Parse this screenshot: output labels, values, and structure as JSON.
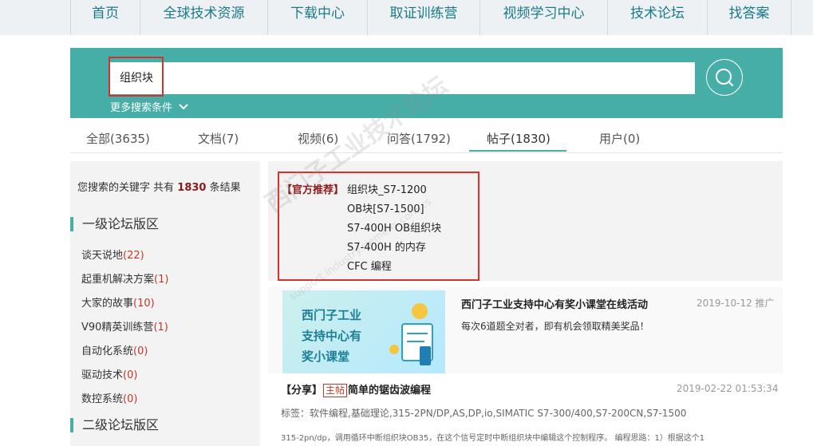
{
  "nav": {
    "items": [
      "首页",
      "全球技术资源",
      "下载中心",
      "取证训练营",
      "视频学习中心",
      "技术论坛",
      "找答案"
    ]
  },
  "search": {
    "value": "组织块",
    "more_conditions": "更多搜索条件"
  },
  "tabs": [
    {
      "label": "全部(3635)"
    },
    {
      "label": "文档(7)"
    },
    {
      "label": "视频(6)"
    },
    {
      "label": "问答(1792)"
    },
    {
      "label": "帖子(1830)",
      "active": true
    },
    {
      "label": "用户(0)"
    }
  ],
  "sidebar": {
    "summary_prefix": "您搜索的关键字 共有",
    "summary_count": "1830",
    "summary_suffix": "条结果",
    "section1_title": "一级论坛版区",
    "forums": [
      {
        "name": "谈天说地",
        "count": "(22)"
      },
      {
        "name": "起重机解决方案",
        "count": "(1)"
      },
      {
        "name": "大家的故事",
        "count": "(10)"
      },
      {
        "name": "V90精英训练营",
        "count": "(1)"
      },
      {
        "name": "自动化系统",
        "count": "(0)"
      },
      {
        "name": "驱动技术",
        "count": "(0)"
      },
      {
        "name": "数控系统",
        "count": "(0)"
      }
    ],
    "section2_title": "二级论坛版区"
  },
  "recommend": {
    "tag": "【官方推荐】",
    "links": [
      "组织块_S7-1200",
      "OB块[S7-1500]",
      "S7-400H OB组织块",
      "S7-400H 的内存",
      "CFC 编程"
    ]
  },
  "promo": {
    "image_lines": [
      "西门子工业",
      "支持中心有",
      "奖小课堂"
    ],
    "title": "西门子工业支持中心有奖小课堂在线活动",
    "date": "2019-10-12 推广",
    "desc": "每次6道题全对者，即有机会领取精美奖品！"
  },
  "post": {
    "prefix": "【分享】",
    "badge": "主帖",
    "title": "简单的锯齿波编程",
    "date": "2019-02-22 01:53:34",
    "tags": "标签：软件编程,基础理论,315-2PN/DP,AS,DP,io,SIMATIC S7-300/400,S7-200CN,S7-1500",
    "snippet": "315-2pn/dp，调用循环中断组织块OB35，在这个信号定时中断组织块中编辑这个控制程序。 编程思路：1）根据这个1"
  },
  "watermark": {
    "text": "西门子工业技术论坛",
    "url": "support.industry.siemens.com/cs"
  },
  "colors": {
    "teal": "#46ada7",
    "highlight_red": "#d9302c",
    "count_red": "#c0392b"
  }
}
